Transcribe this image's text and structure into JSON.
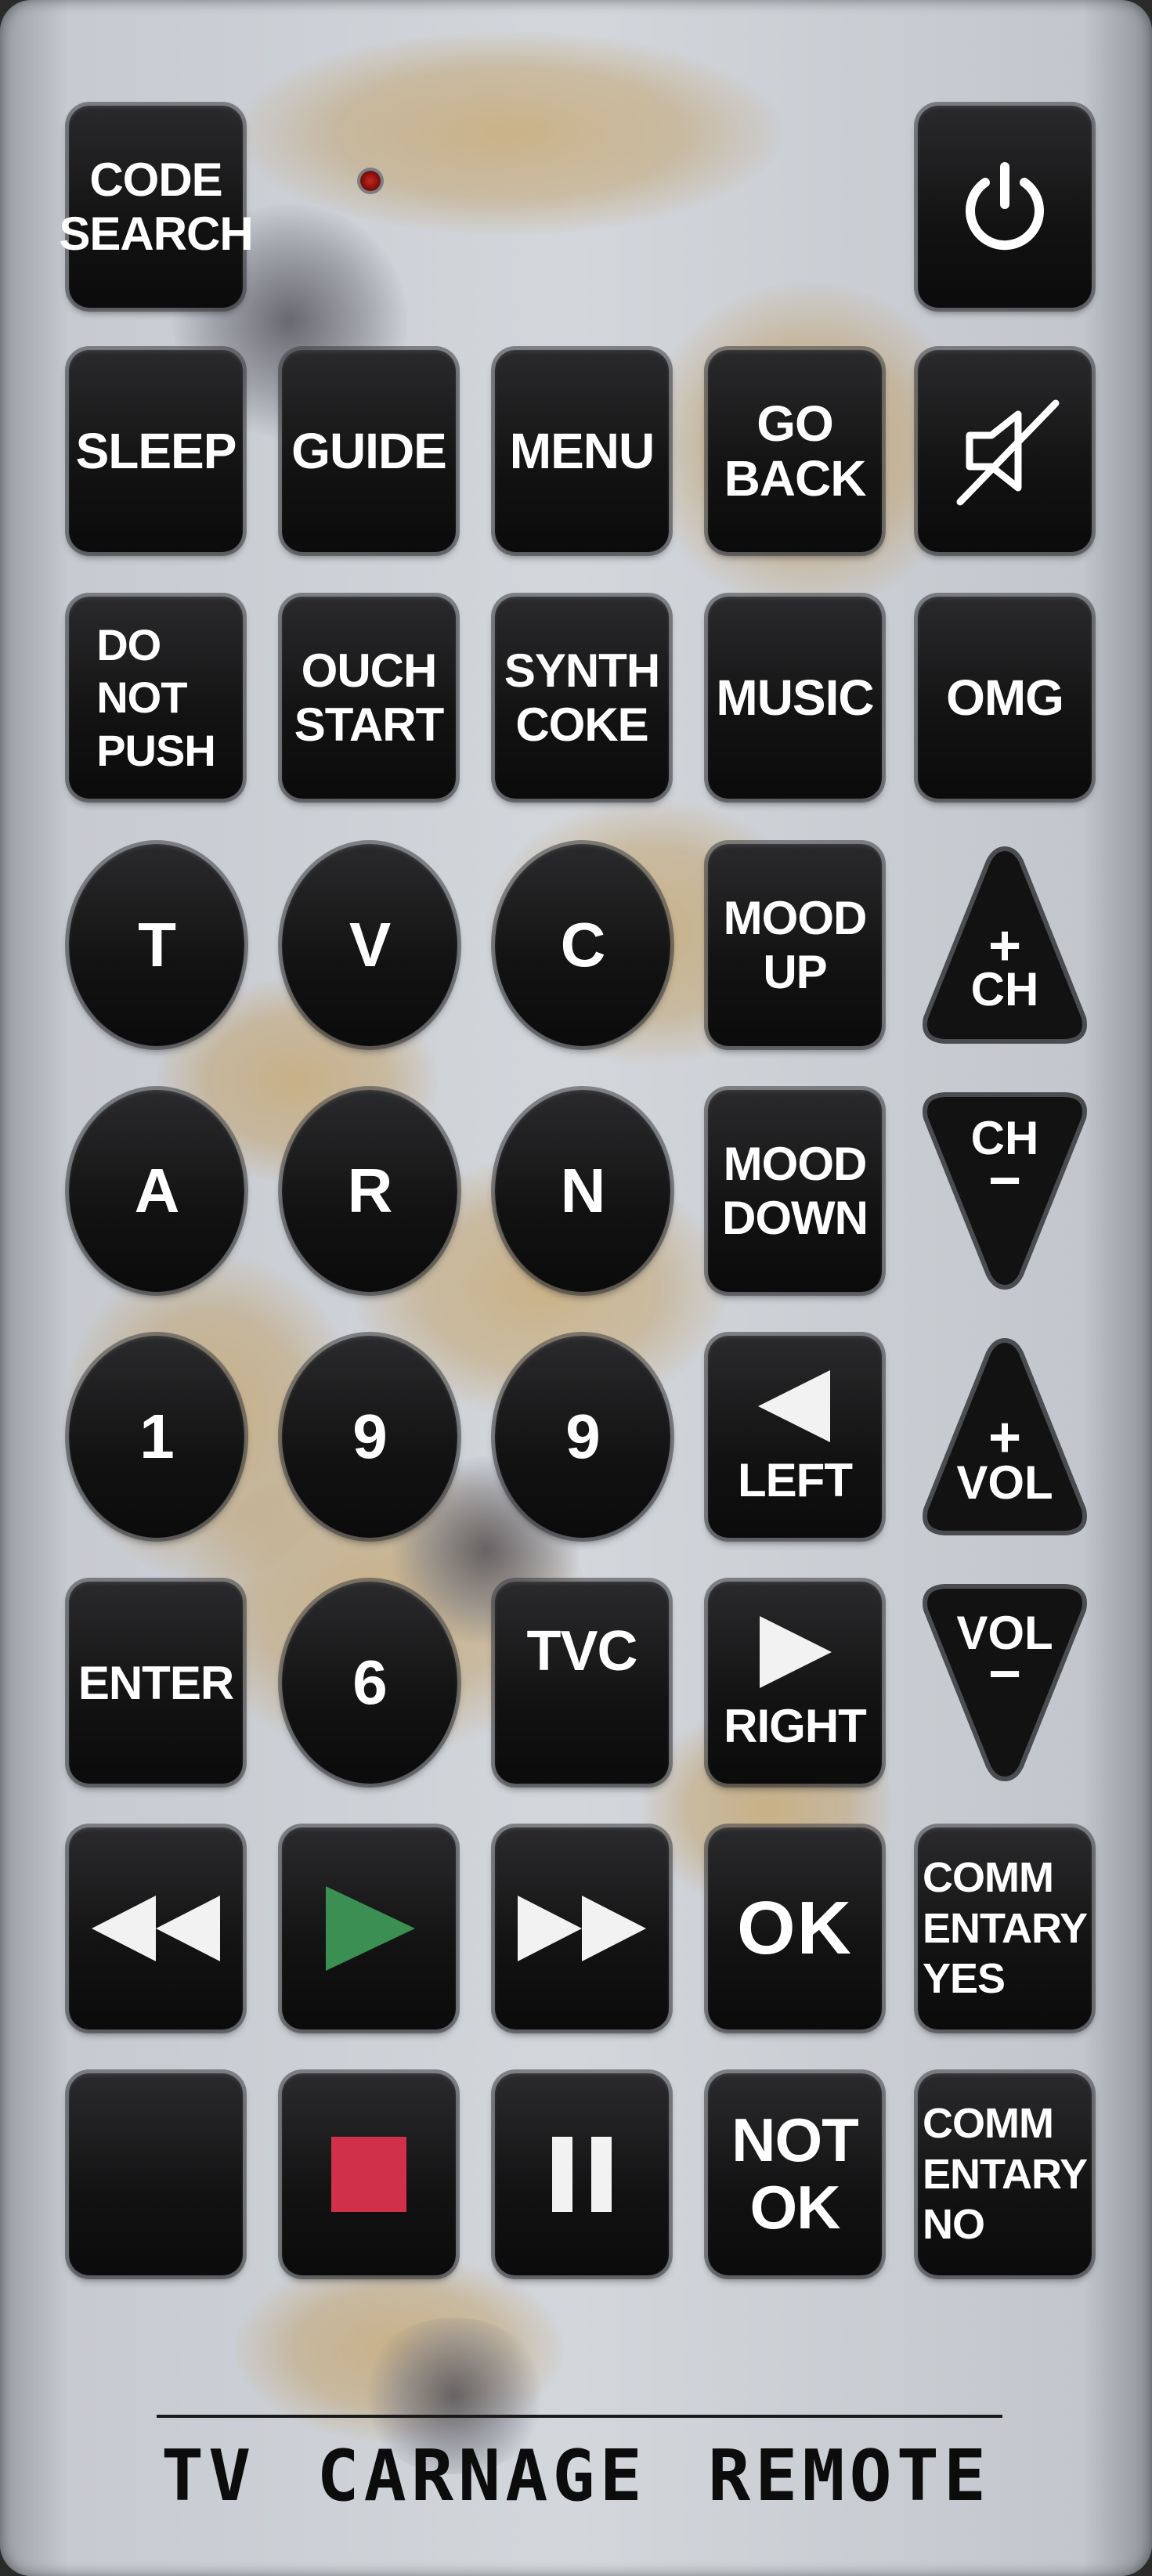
{
  "remote": {
    "brand_label": "TV CARNAGE REMOTE",
    "colors": {
      "body": "#cfd2d7",
      "button": "#141415",
      "play_triangle": "#3b8f52",
      "stop_square": "#d0304a",
      "indicator_led": "#c8281e"
    },
    "buttons": {
      "code_search": "CODE\nSEARCH",
      "power_icon": "power-icon",
      "sleep": "SLEEP",
      "guide": "GUIDE",
      "menu": "MENU",
      "go_back": "GO\nBACK",
      "mute_icon": "mute-icon",
      "do_not_push": "DO\nNOT\nPUSH",
      "ouch_start": "OUCH\nSTART",
      "synth_coke": "SYNTH\nCOKE",
      "music": "MUSIC",
      "omg": "OMG",
      "letter_t": "T",
      "letter_v": "V",
      "letter_c": "C",
      "mood_up": "MOOD\nUP",
      "ch_up_plus": "+",
      "ch_up_label": "CH",
      "letter_a": "A",
      "letter_r": "R",
      "letter_n": "N",
      "mood_down": "MOOD\nDOWN",
      "ch_down_label": "CH",
      "ch_down_minus": "−",
      "num_1": "1",
      "num_9a": "9",
      "num_9b": "9",
      "left": "LEFT",
      "vol_up_plus": "+",
      "vol_up_label": "VOL",
      "enter": "ENTER",
      "num_6": "6",
      "tvc": "TVC",
      "right": "RIGHT",
      "vol_down_label": "VOL",
      "vol_down_minus": "−",
      "rewind_icon": "rewind-icon",
      "play_icon": "play-icon",
      "fast_forward_icon": "fast-forward-icon",
      "ok": "OK",
      "commentary_yes": "COMM\nENTARY\nYES",
      "stop_icon": "stop-icon",
      "pause_icon": "pause-icon",
      "not_ok": "NOT\nOK",
      "commentary_no": "COMM\nENTARY\nNO"
    }
  }
}
